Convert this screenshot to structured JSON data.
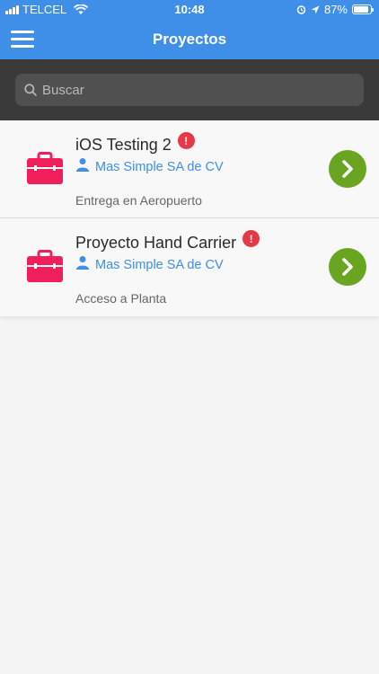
{
  "status_bar": {
    "carrier": "TELCEL",
    "time": "10:48",
    "battery": "87%",
    "battery_level": 0.87
  },
  "header": {
    "title": "Proyectos",
    "menu_icon": "hamburger-menu-icon",
    "background": "#3f8ee8"
  },
  "search": {
    "placeholder": "Buscar",
    "value": "",
    "icon": "search-icon"
  },
  "projects": [
    {
      "title": "iOS Testing 2",
      "alert": "!",
      "client": "Mas Simple SA de CV",
      "description": "Entrega en Aeropuerto"
    },
    {
      "title": "Proyecto Hand Carrier",
      "alert": "!",
      "client": "Mas Simple SA de CV",
      "description": "Acceso a Planta"
    }
  ],
  "colors": {
    "accent": "#3f8ee8",
    "case_icon": "#f01f5c",
    "go_button": "#6aa521",
    "alert": "#e63946"
  }
}
